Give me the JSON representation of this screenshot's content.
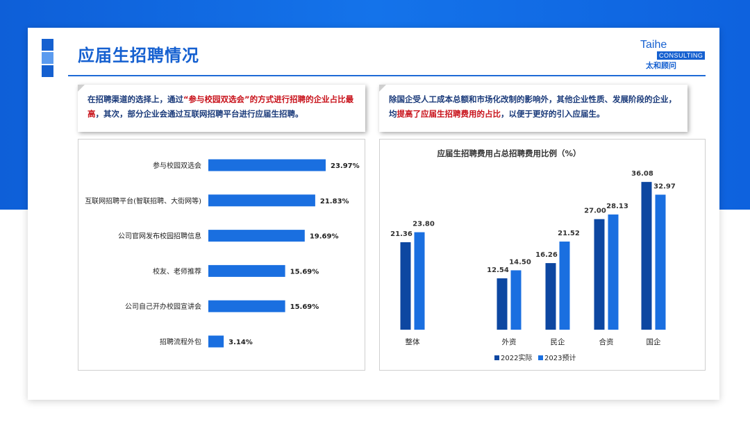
{
  "title": "应届生招聘情况",
  "logo": {
    "brand": "Taihe",
    "sub": "CONSULTING",
    "cn": "太和顾问"
  },
  "colors": {
    "primary": "#1560d0",
    "bar_blue": "#1a6fe0",
    "dark_blue": "#0d47a1",
    "highlight": "#c8111a"
  },
  "callouts": {
    "left": {
      "p1": "在招聘渠道的选择上，通过",
      "hl": "“参与校园双选会”的方式进行招聘的企业占比最高",
      "p2": "，其次，部分企业会通过互联网招聘平台进行应届生招聘。"
    },
    "right": {
      "p1": "除国企受人工成本总额和市场化改制的影响外，其他企业性质、发展阶段的企业，均",
      "hl": "提高了应届生招聘费用的占比",
      "p2": "，以便于更好的引入应届生。"
    }
  },
  "chart_data": [
    {
      "type": "bar",
      "orientation": "horizontal",
      "title": "",
      "categories": [
        "参与校园双选会",
        "互联网招聘平台(智联招聘、大街网等)",
        "公司官网发布校园招聘信息",
        "校友、老师推荐",
        "公司自己开办校园宣讲会",
        "招聘流程外包"
      ],
      "values": [
        23.97,
        21.83,
        19.69,
        15.69,
        15.69,
        3.14
      ],
      "value_labels": [
        "23.97%",
        "21.83%",
        "19.69%",
        "15.69%",
        "15.69%",
        "3.14%"
      ],
      "xlim": [
        0,
        30
      ]
    },
    {
      "type": "bar",
      "title": "应届生招聘费用占总招聘费用比例（%）",
      "categories": [
        "整体",
        "外资",
        "民企",
        "合资",
        "国企"
      ],
      "series": [
        {
          "name": "2022实际",
          "values": [
            21.36,
            12.54,
            16.26,
            27.0,
            36.08
          ],
          "labels": [
            "21.36",
            "12.54",
            "16.26",
            "27.00",
            "36.08"
          ]
        },
        {
          "name": "2023预计",
          "values": [
            23.8,
            14.5,
            21.52,
            28.13,
            32.97
          ],
          "labels": [
            "23.80",
            "14.50",
            "21.52",
            "28.13",
            "32.97"
          ]
        }
      ],
      "ylim": [
        0,
        40
      ],
      "legend": "bottom",
      "grid": false
    }
  ]
}
